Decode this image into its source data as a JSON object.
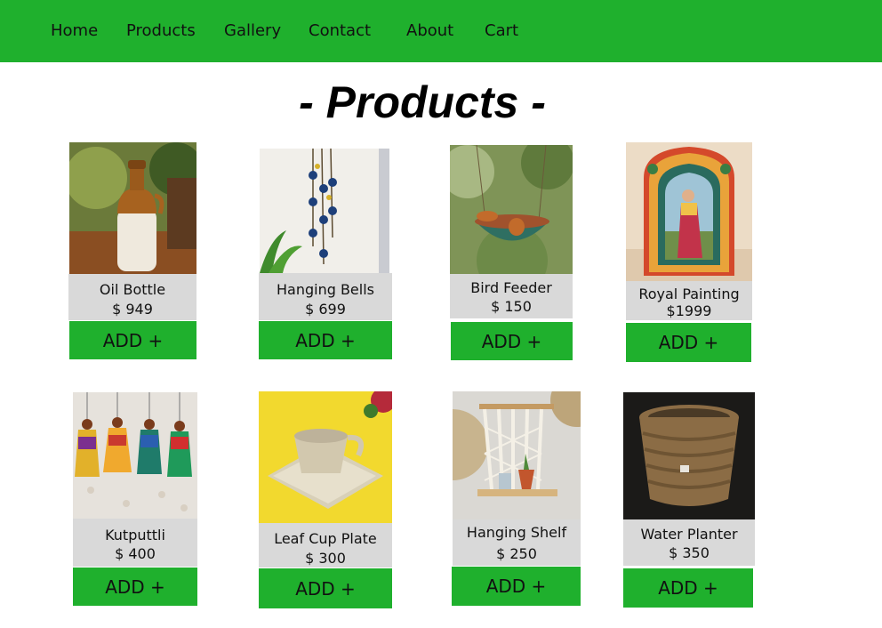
{
  "nav": {
    "home": "Home",
    "products": "Products",
    "gallery": "Gallery",
    "contact": "Contact",
    "about": "About",
    "cart": "Cart"
  },
  "page_title": "- Products -",
  "products": [
    {
      "name": "Oil Bottle",
      "price": "$ 949",
      "button": "ADD +"
    },
    {
      "name": "Hanging Bells",
      "price": "$ 699",
      "button": "ADD +"
    },
    {
      "name": "Bird Feeder",
      "price": "$ 150",
      "button": "ADD +"
    },
    {
      "name": "Royal Painting",
      "price": "$1999",
      "button": "ADD +"
    },
    {
      "name": "Kutputtli",
      "price": "$ 400",
      "button": "ADD +"
    },
    {
      "name": "Leaf Cup Plate",
      "price": "$ 300",
      "button": "ADD +"
    },
    {
      "name": "Hanging Shelf",
      "price": "$ 250",
      "button": "ADD +"
    },
    {
      "name": "Water Planter",
      "price": "$ 350",
      "button": "ADD +"
    }
  ],
  "colors": {
    "accent": "#1fb02d",
    "info_bg": "#d9d9d9"
  }
}
